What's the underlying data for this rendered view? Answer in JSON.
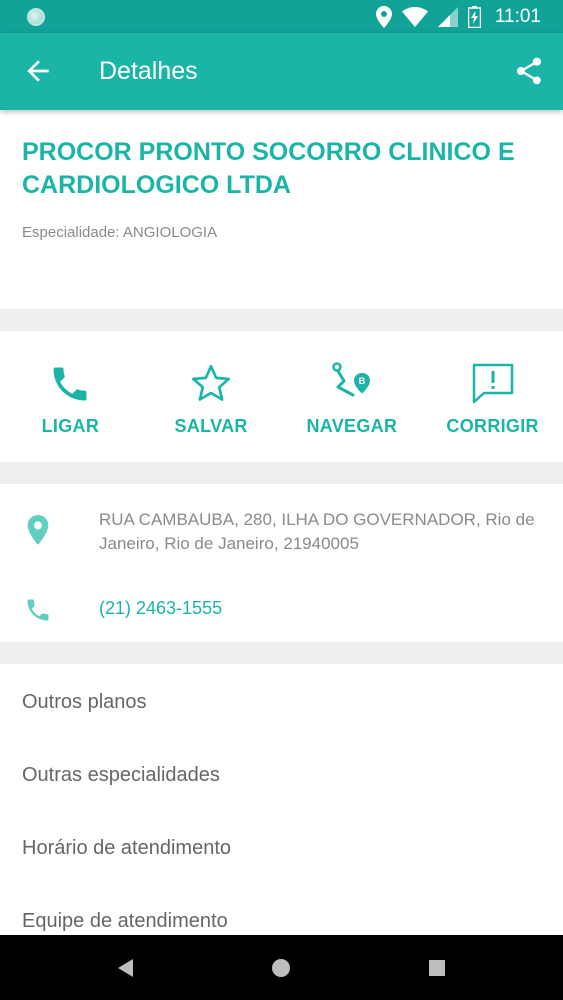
{
  "status_bar": {
    "time": "11:01",
    "icons": [
      "location-icon",
      "wifi-icon",
      "signal-icon",
      "battery-icon"
    ]
  },
  "app_bar": {
    "title": "Detalhes",
    "back_icon": "arrow-back-icon",
    "share_icon": "share-icon"
  },
  "facility": {
    "name": "PROCOR PRONTO SOCORRO CLINICO E CARDIOLOGICO LTDA",
    "specialty": "Especialidade: ANGIOLOGIA"
  },
  "actions": [
    {
      "label": "LIGAR",
      "icon": "phone-icon"
    },
    {
      "label": "SALVAR",
      "icon": "star-icon"
    },
    {
      "label": "NAVEGAR",
      "icon": "route-icon"
    },
    {
      "label": "CORRIGIR",
      "icon": "report-icon"
    }
  ],
  "contact": {
    "address": "RUA CAMBAUBA, 280, ILHA DO GOVERNADOR, Rio de Janeiro, Rio de Janeiro, 21940005",
    "phone": "(21) 2463-1555"
  },
  "menu": [
    {
      "label": "Outros planos"
    },
    {
      "label": "Outras especialidades"
    },
    {
      "label": "Horário de atendimento"
    },
    {
      "label": "Equipe de atendimento"
    }
  ],
  "colors": {
    "status_bar": "#11a398",
    "accent": "#1bb5a8",
    "divider": "#eeeeee",
    "muted_text": "#8a8a8a"
  }
}
